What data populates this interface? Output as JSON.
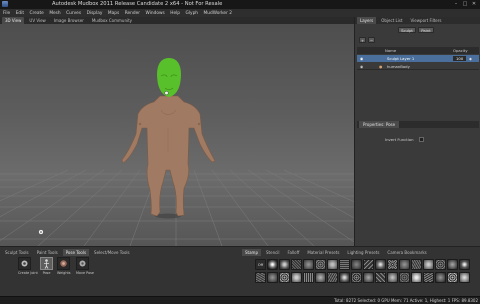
{
  "titlebar": {
    "title": "Autodesk Mudbox 2011 Release Candidate 2 x64 - Not For Resale",
    "minimize": "–",
    "maximize": "□",
    "close": "✕"
  },
  "menubar": {
    "items": [
      "File",
      "Edit",
      "Create",
      "Mesh",
      "Curves",
      "Display",
      "Maps",
      "Render",
      "Windows",
      "Help",
      "Glyph",
      "MudWorker 2"
    ]
  },
  "viewtabs": {
    "items": [
      "3D View",
      "UV View",
      "Image Browser",
      "Mudbox Community"
    ],
    "active_index": 0
  },
  "layers_panel": {
    "tabs": [
      "Layers",
      "Object List",
      "Viewport Filters"
    ],
    "active_tab_index": 0,
    "sculpt_button": "Sculpt",
    "paint_button": "Paint",
    "header_name": "Name",
    "header_opacity": "Opacity",
    "rows": [
      {
        "name": "Sculpt Layer 1",
        "opacity": "100",
        "selected": true
      },
      {
        "name": "humanBody",
        "opacity": "",
        "selected": false
      }
    ]
  },
  "properties": {
    "tab": "Properties: Pose",
    "invert_function_label": "Invert Function"
  },
  "tool_tray": {
    "tabs": [
      "Sculpt Tools",
      "Paint Tools",
      "Pose Tools",
      "Select/Move Tools"
    ],
    "active_tab_index": 2,
    "tools": [
      {
        "label": "Create Joint",
        "icon": "joint-icon",
        "selected": false
      },
      {
        "label": "Pose",
        "icon": "pose-icon",
        "selected": true
      },
      {
        "label": "Weights",
        "icon": "weights-icon",
        "selected": false
      },
      {
        "label": "Move Pose",
        "icon": "move-pose-icon",
        "selected": false
      }
    ]
  },
  "stamp_tray": {
    "tabs": [
      "Stamp",
      "Stencil",
      "Falloff",
      "Material Presets",
      "Lighting Presets",
      "Camera Bookmarks"
    ],
    "active_tab_index": 0,
    "off_label": "Off"
  },
  "statusbar": {
    "text": "Total: 8272 Selected: 0 GPU Mem: 71 Active: 1, Highest: 1 FPS: 89.8302"
  },
  "colors": {
    "mask_green": "#58c02a",
    "skin": "#a07a62",
    "selection_blue": "#4a6f9c"
  }
}
